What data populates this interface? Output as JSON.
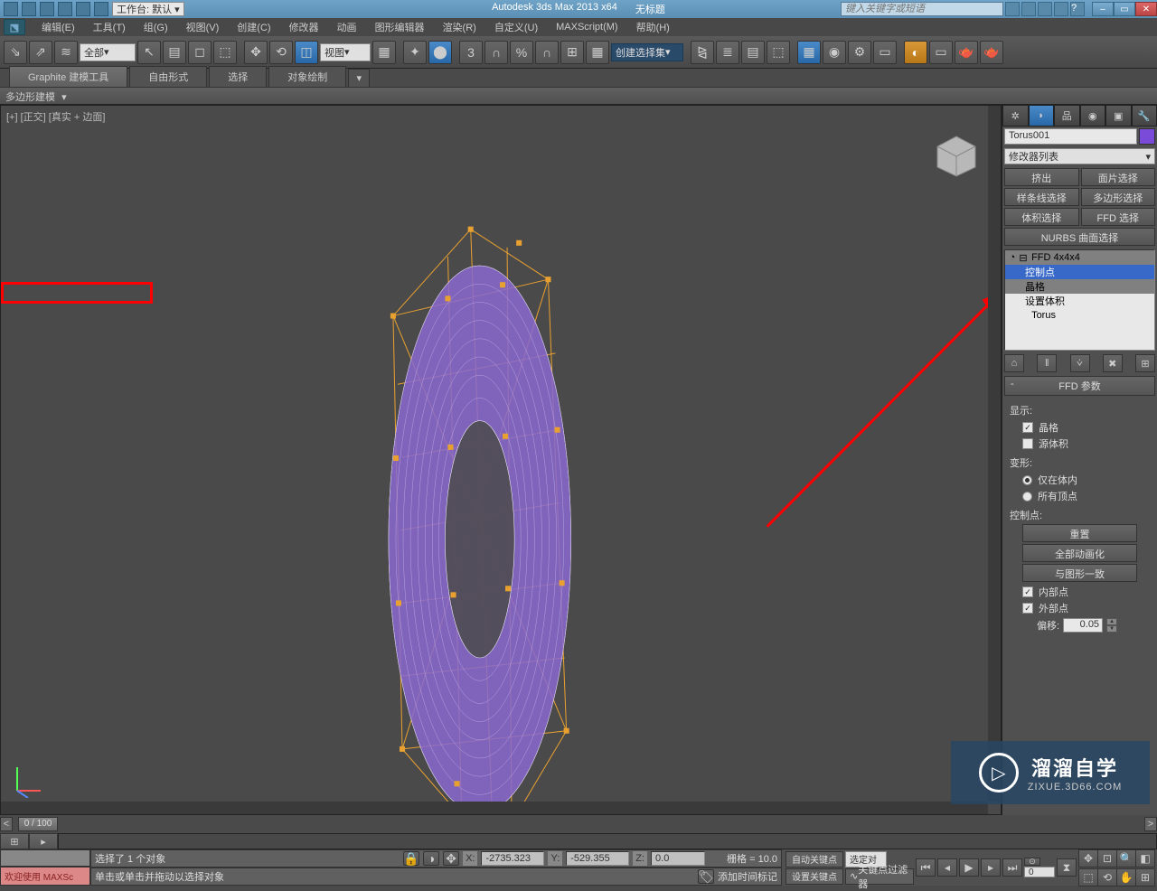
{
  "title": {
    "app": "Autodesk 3ds Max  2013 x64",
    "doc": "无标题",
    "workspace_label": "工作台: 默认",
    "search_placeholder": "键入关键字或短语"
  },
  "menu": {
    "edit": "编辑(E)",
    "tools": "工具(T)",
    "group": "组(G)",
    "views": "视图(V)",
    "create": "创建(C)",
    "modifiers": "修改器",
    "anim": "动画",
    "graph": "图形编辑器",
    "render": "渲染(R)",
    "custom": "自定义(U)",
    "maxscript": "MAXScript(M)",
    "help": "帮助(H)"
  },
  "maintb": {
    "filter": "全部",
    "view_drop": "视图",
    "selset": "创建选择集"
  },
  "ribbon": {
    "tabs": [
      "Graphite 建模工具",
      "自由形式",
      "选择",
      "对象绘制"
    ],
    "bar": "多边形建模"
  },
  "viewport": {
    "label": "[+] [正交] [真实 + 边面]"
  },
  "cmd": {
    "objname": "Torus001",
    "modlist": "修改器列表",
    "sel_btns": [
      "挤出",
      "面片选择",
      "样条线选择",
      "多边形选择",
      "体积选择",
      "FFD 选择",
      "NURBS 曲面选择"
    ],
    "stack": {
      "mod": "FFD 4x4x4",
      "sub": [
        "控制点",
        "晶格",
        "设置体积"
      ],
      "base": "Torus"
    },
    "rollout": {
      "title": "FFD 参数",
      "display": "显示:",
      "lattice": "晶格",
      "source_vol": "源体积",
      "deform": "变形:",
      "in_vol": "仅在体内",
      "all_vert": "所有顶点",
      "ctrl_pts": "控制点:",
      "reset": "重置",
      "anim_all": "全部动画化",
      "conform": "与图形一致",
      "inner": "内部点",
      "outer": "外部点",
      "offset": "偏移:",
      "offset_val": "0.05"
    }
  },
  "timeline": {
    "pos": "0 / 100"
  },
  "status": {
    "welcome": "欢迎使用  MAXSc",
    "sel": "选择了 1 个对象",
    "prompt": "单击或单击并拖动以选择对象",
    "x": "-2735.323",
    "y": "-529.355",
    "z": "0.0",
    "grid": "栅格 = 10.0",
    "addtime": "添加时间标记",
    "autokey": "自动关键点",
    "setkey": "设置关键点",
    "selfilter": "选定对",
    "keyfilter": "关键点过滤器"
  },
  "watermark": {
    "t1": "溜溜自学",
    "t2": "ZIXUE.3D66.COM"
  },
  "chart_data": null
}
